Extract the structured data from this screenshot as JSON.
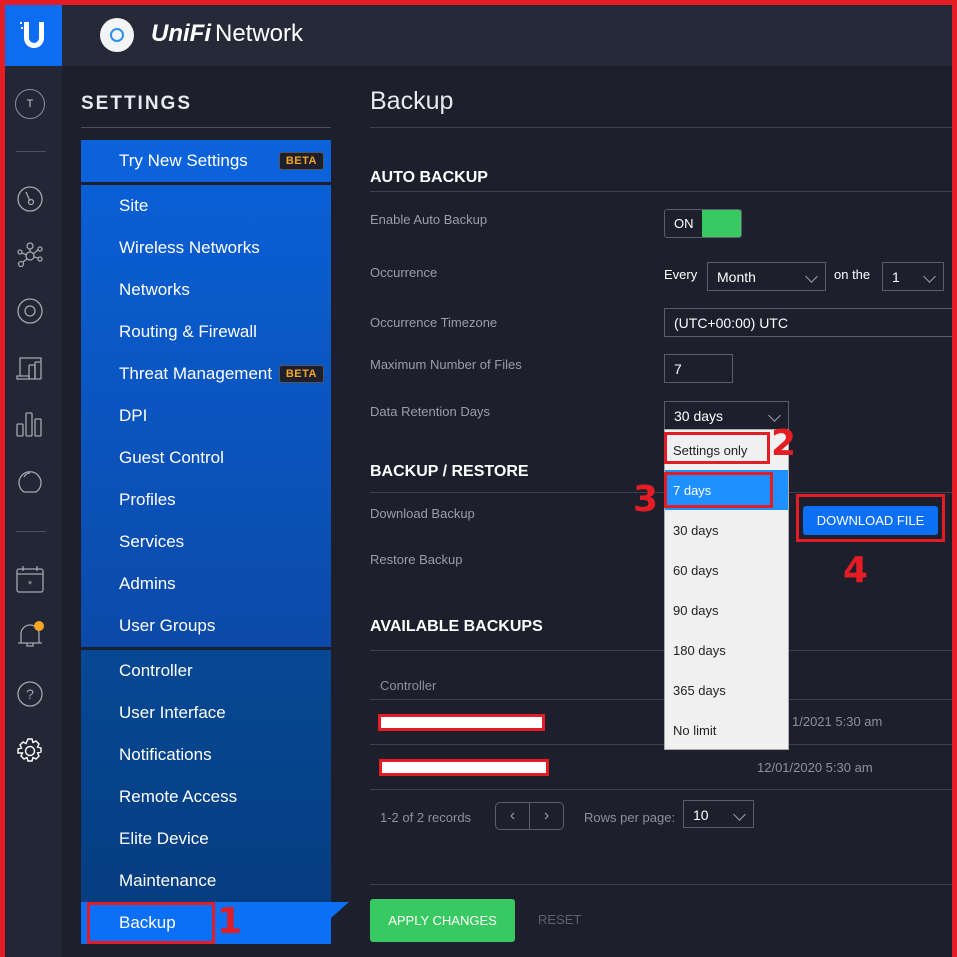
{
  "header": {
    "brand": "UniFi",
    "product": "Network"
  },
  "rail": {
    "avatar_initial": "T"
  },
  "settings": {
    "title": "SETTINGS",
    "try_new": {
      "label": "Try New Settings",
      "badge": "BETA"
    },
    "group1": [
      {
        "label": "Site"
      },
      {
        "label": "Wireless Networks"
      },
      {
        "label": "Networks"
      },
      {
        "label": "Routing & Firewall"
      },
      {
        "label": "Threat Management",
        "badge": "BETA"
      },
      {
        "label": "DPI"
      },
      {
        "label": "Guest Control"
      },
      {
        "label": "Profiles"
      },
      {
        "label": "Services"
      },
      {
        "label": "Admins"
      },
      {
        "label": "User Groups"
      }
    ],
    "group2": [
      {
        "label": "Controller"
      },
      {
        "label": "User Interface"
      },
      {
        "label": "Notifications"
      },
      {
        "label": "Remote Access"
      },
      {
        "label": "Elite Device"
      },
      {
        "label": "Maintenance"
      }
    ],
    "active": {
      "label": "Backup"
    }
  },
  "main": {
    "title": "Backup",
    "auto_backup": {
      "title": "AUTO BACKUP",
      "enable_label": "Enable Auto Backup",
      "enable_value": "ON",
      "occurrence_label": "Occurrence",
      "every_text": "Every",
      "every_value": "Month",
      "on_the_text": "on the",
      "on_the_value": "1",
      "timezone_label": "Occurrence Timezone",
      "timezone_value": "(UTC+00:00) UTC",
      "max_files_label": "Maximum Number of Files",
      "max_files_value": "7",
      "retention_label": "Data Retention Days",
      "retention_value": "30 days",
      "retention_options": [
        "Settings only",
        "7 days",
        "30 days",
        "60 days",
        "90 days",
        "180 days",
        "365 days",
        "No limit"
      ],
      "retention_highlighted": "7 days"
    },
    "backup_restore": {
      "title": "BACKUP / RESTORE",
      "download_label": "Download Backup",
      "download_button": "DOWNLOAD FILE",
      "restore_label": "Restore Backup"
    },
    "available": {
      "title": "AVAILABLE BACKUPS",
      "column": "Controller",
      "rows": [
        {
          "date": "1/2021 5:30 am"
        },
        {
          "date": "12/01/2020 5:30 am"
        }
      ],
      "records": "1-2 of 2 records",
      "rows_per_page_label": "Rows per page:",
      "rows_per_page_value": "10"
    },
    "apply_button": "APPLY CHANGES",
    "reset_button": "RESET"
  },
  "annotations": [
    "1",
    "2",
    "3",
    "4"
  ]
}
